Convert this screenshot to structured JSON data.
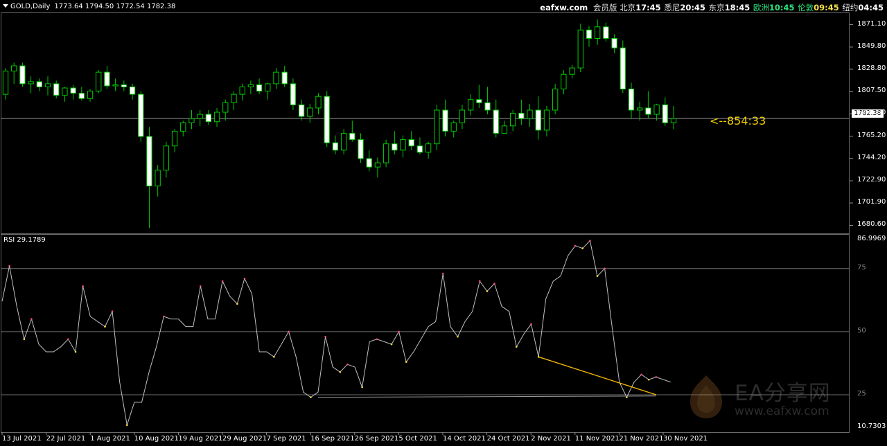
{
  "header": {
    "symbol": "GOLD,Daily",
    "ohlc": "1773.64 1794.50 1772.54 1782.38"
  },
  "clock_bar": {
    "site": "eafxw.com",
    "member": "会员版",
    "beijing_label": "北京",
    "beijing_time": "17:45",
    "sydney_label": "悉尼",
    "sydney_time": "20:45",
    "tokyo_label": "东京",
    "tokyo_time": "18:45",
    "europe_label": "欧洲",
    "europe_time": "10:45",
    "london_label": "伦敦",
    "london_time": "09:45",
    "newyork_label": "纽约",
    "newyork_time": "04:45"
  },
  "price_axis": [
    "1871.10",
    "1849.80",
    "1828.80",
    "1807.50",
    "1786.50",
    "1765.20",
    "1744.20",
    "1722.90",
    "1701.90",
    "1680.60"
  ],
  "bid_tag": "1782.38",
  "countdown": "<--854:33",
  "rsi": {
    "title": "RSI 29.1789",
    "axis": [
      "86.9969",
      "75",
      "50",
      "25",
      "10.7303"
    ]
  },
  "date_axis": [
    "13 Jul 2021",
    "22 Jul 2021",
    "1 Aug 2021",
    "10 Aug 2021",
    "19 Aug 2021",
    "29 Aug 2021",
    "7 Sep 2021",
    "16 Sep 2021",
    "26 Sep 2021",
    "5 Oct 2021",
    "14 Oct 2021",
    "24 Oct 2021",
    "2 Nov 2021",
    "11 Nov 2021",
    "21 Nov 2021",
    "30 Nov 2021"
  ],
  "watermark": {
    "text": "EA分享网",
    "url": "www.eafxw.com"
  },
  "colors": {
    "bull_body": "#000000",
    "bear_body": "#ffffff",
    "wick": "#00cc00",
    "rsi_line": "#c0c0c0",
    "rsi_level": "#6e6e6e",
    "divergence": "#f2b705",
    "countdown": "#f2d000"
  },
  "chart_data": {
    "type": "candlestick",
    "title": "GOLD,Daily",
    "ylim": [
      1675,
      1880
    ],
    "candles": [
      [
        1805,
        1830,
        1800,
        1827
      ],
      [
        1827,
        1835,
        1815,
        1832
      ],
      [
        1832,
        1835,
        1812,
        1815
      ],
      [
        1815,
        1822,
        1806,
        1817
      ],
      [
        1817,
        1820,
        1808,
        1812
      ],
      [
        1812,
        1822,
        1804,
        1815
      ],
      [
        1815,
        1818,
        1801,
        1804
      ],
      [
        1804,
        1812,
        1798,
        1811
      ],
      [
        1811,
        1814,
        1800,
        1806
      ],
      [
        1806,
        1812,
        1799,
        1801
      ],
      [
        1801,
        1810,
        1798,
        1808
      ],
      [
        1808,
        1828,
        1806,
        1826
      ],
      [
        1826,
        1832,
        1810,
        1813
      ],
      [
        1813,
        1820,
        1808,
        1814
      ],
      [
        1814,
        1818,
        1808,
        1812
      ],
      [
        1812,
        1815,
        1800,
        1805
      ],
      [
        1805,
        1808,
        1760,
        1765
      ],
      [
        1765,
        1774,
        1678,
        1718
      ],
      [
        1718,
        1738,
        1708,
        1733
      ],
      [
        1733,
        1760,
        1726,
        1756
      ],
      [
        1756,
        1772,
        1750,
        1770
      ],
      [
        1770,
        1780,
        1765,
        1778
      ],
      [
        1778,
        1790,
        1772,
        1782
      ],
      [
        1782,
        1790,
        1775,
        1786
      ],
      [
        1786,
        1790,
        1776,
        1779
      ],
      [
        1779,
        1792,
        1774,
        1788
      ],
      [
        1788,
        1800,
        1780,
        1797
      ],
      [
        1797,
        1808,
        1790,
        1805
      ],
      [
        1805,
        1815,
        1799,
        1812
      ],
      [
        1812,
        1818,
        1805,
        1814
      ],
      [
        1814,
        1820,
        1805,
        1808
      ],
      [
        1808,
        1816,
        1800,
        1815
      ],
      [
        1815,
        1830,
        1810,
        1826
      ],
      [
        1826,
        1832,
        1812,
        1815
      ],
      [
        1815,
        1820,
        1790,
        1795
      ],
      [
        1795,
        1800,
        1780,
        1784
      ],
      [
        1784,
        1796,
        1778,
        1792
      ],
      [
        1792,
        1806,
        1786,
        1803
      ],
      [
        1803,
        1808,
        1755,
        1759
      ],
      [
        1759,
        1766,
        1748,
        1752
      ],
      [
        1752,
        1772,
        1748,
        1768
      ],
      [
        1768,
        1780,
        1760,
        1762
      ],
      [
        1762,
        1768,
        1740,
        1744
      ],
      [
        1744,
        1752,
        1732,
        1736
      ],
      [
        1736,
        1745,
        1726,
        1740
      ],
      [
        1740,
        1762,
        1736,
        1758
      ],
      [
        1758,
        1770,
        1748,
        1752
      ],
      [
        1752,
        1766,
        1745,
        1762
      ],
      [
        1762,
        1770,
        1752,
        1756
      ],
      [
        1756,
        1764,
        1748,
        1750
      ],
      [
        1750,
        1760,
        1744,
        1758
      ],
      [
        1758,
        1795,
        1752,
        1790
      ],
      [
        1790,
        1800,
        1765,
        1770
      ],
      [
        1770,
        1780,
        1764,
        1778
      ],
      [
        1778,
        1795,
        1772,
        1790
      ],
      [
        1790,
        1805,
        1785,
        1800
      ],
      [
        1800,
        1814,
        1792,
        1797
      ],
      [
        1797,
        1812,
        1786,
        1790
      ],
      [
        1790,
        1800,
        1764,
        1768
      ],
      [
        1768,
        1780,
        1770,
        1775
      ],
      [
        1775,
        1790,
        1770,
        1787
      ],
      [
        1787,
        1800,
        1776,
        1782
      ],
      [
        1782,
        1796,
        1774,
        1790
      ],
      [
        1790,
        1803,
        1762,
        1771
      ],
      [
        1771,
        1794,
        1765,
        1790
      ],
      [
        1790,
        1815,
        1786,
        1810
      ],
      [
        1810,
        1828,
        1805,
        1824
      ],
      [
        1824,
        1833,
        1820,
        1830
      ],
      [
        1830,
        1872,
        1826,
        1866
      ],
      [
        1866,
        1870,
        1850,
        1858
      ],
      [
        1858,
        1876,
        1852,
        1869
      ],
      [
        1869,
        1873,
        1855,
        1858
      ],
      [
        1858,
        1862,
        1844,
        1849
      ],
      [
        1849,
        1856,
        1806,
        1810
      ],
      [
        1810,
        1816,
        1782,
        1790
      ],
      [
        1790,
        1798,
        1780,
        1792
      ],
      [
        1792,
        1808,
        1782,
        1786
      ],
      [
        1786,
        1796,
        1780,
        1795
      ],
      [
        1795,
        1802,
        1775,
        1778
      ],
      [
        1778,
        1794,
        1772,
        1782
      ]
    ],
    "rsi": {
      "ylim": [
        10.7303,
        86.9969
      ],
      "levels": [
        75,
        50,
        25
      ],
      "values": [
        62,
        76,
        60,
        47,
        55,
        45,
        42,
        42,
        44,
        47,
        42,
        68,
        56,
        54,
        52,
        58,
        30,
        13,
        22,
        22,
        34,
        44,
        56,
        55,
        55,
        52,
        52,
        68,
        55,
        55,
        70,
        64,
        61,
        71,
        65,
        42,
        42,
        40,
        45,
        50,
        40,
        26,
        24,
        26,
        48,
        36,
        34,
        37,
        36,
        28,
        46,
        47,
        46,
        45,
        50,
        38,
        42,
        47,
        52,
        54,
        73,
        52,
        48,
        54,
        58,
        70,
        66,
        69,
        60,
        58,
        44,
        49,
        53,
        40,
        63,
        70,
        72,
        80,
        84,
        83,
        86,
        72,
        75,
        52,
        30,
        24,
        30,
        33,
        31,
        32,
        31,
        30
      ],
      "divergence": [
        [
          73,
          40
        ],
        [
          89,
          25
        ]
      ]
    }
  }
}
